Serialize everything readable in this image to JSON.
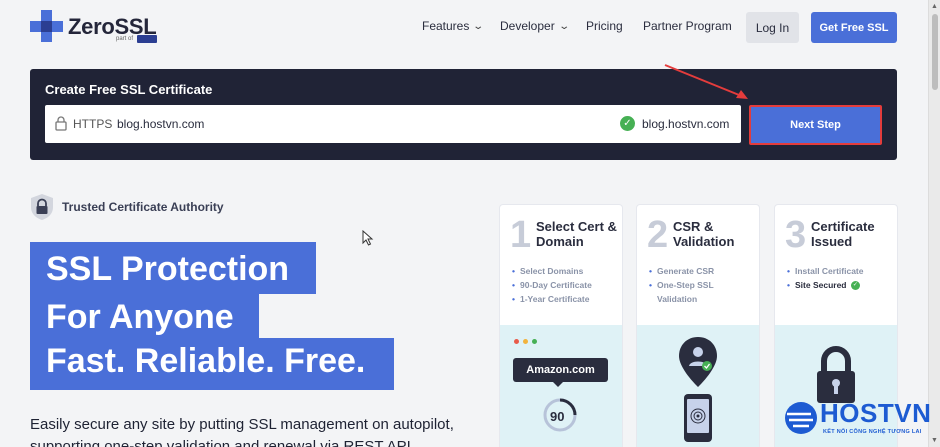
{
  "nav": {
    "logo_text": "ZeroSSL",
    "logo_sub": "part of",
    "links": [
      {
        "label": "Features",
        "chevron": true
      },
      {
        "label": "Developer",
        "chevron": true
      },
      {
        "label": "Pricing",
        "chevron": false
      },
      {
        "label": "Partner Program",
        "chevron": false
      }
    ],
    "login_label": "Log In",
    "cta_label": "Get Free SSL"
  },
  "create_panel": {
    "title": "Create Free SSL Certificate",
    "protocol": "HTTPS",
    "domain_value": "blog.hostvn.com",
    "verified_domain": "blog.hostvn.com",
    "next_label": "Next Step"
  },
  "trust": {
    "label": "Trusted Certificate Authority"
  },
  "hero": {
    "line1": "SSL Protection",
    "line2": "For Anyone",
    "line3": "Fast. Reliable. Free.",
    "description": "Easily secure any site by putting SSL management on autopilot, supporting one-step validation and renewal via REST API."
  },
  "steps": [
    {
      "number": "1",
      "title": "Select Cert & Domain",
      "items": [
        "Select Domains",
        "90-Day Certificate",
        "1-Year Certificate"
      ]
    },
    {
      "number": "2",
      "title": "CSR & Validation",
      "items": [
        "Generate CSR",
        "One-Step SSL Validation"
      ]
    },
    {
      "number": "3",
      "title": "Certificate Issued",
      "items": [
        "Install Certificate",
        "Site Secured"
      ]
    }
  ],
  "illustration": {
    "amazon_label": "Amazon.com",
    "gauge_value": "90"
  },
  "watermark": {
    "brand": "HOSTVN",
    "tagline": "KẾT NỐI CÔNG NGHỆ TƯƠNG LAI"
  },
  "colors": {
    "accent": "#4a6fd8",
    "dark_panel": "#202336",
    "success": "#46b054",
    "highlight_border": "#e43c3c",
    "card_bottom": "#dff2f6"
  }
}
